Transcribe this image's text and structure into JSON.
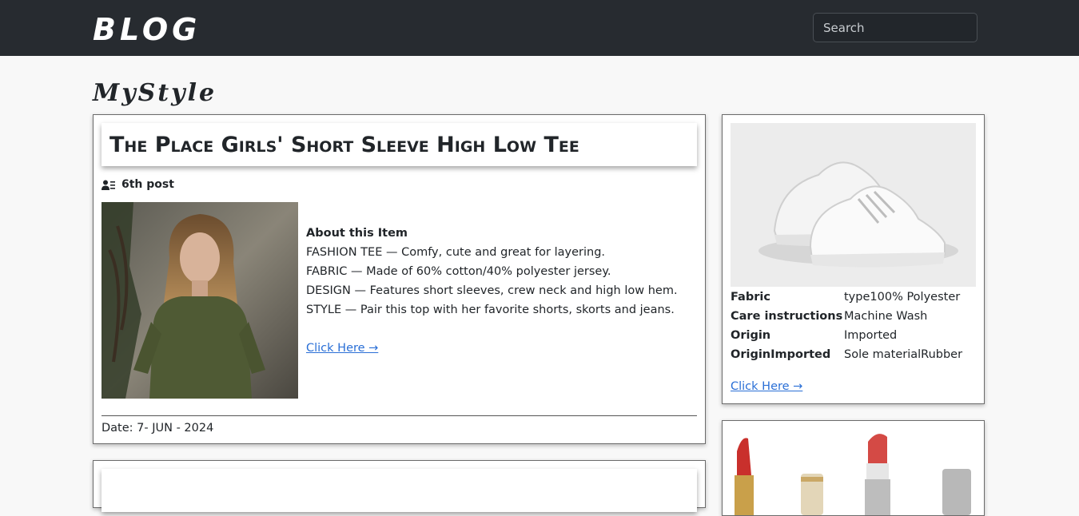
{
  "navbar": {
    "brand": "BLOG",
    "search_placeholder": "Search"
  },
  "site_title": "MyStyle",
  "post": {
    "title": "The Place Girls' Short Sleeve High Low Tee",
    "meta": "6th post",
    "about_heading": "About this Item",
    "lines": [
      "FASHION TEE — Comfy, cute and great for layering.",
      "FABRIC — Made of 60% cotton/40% polyester jersey.",
      "DESIGN — Features short sleeves, crew neck and high low hem.",
      "STYLE — Pair this top with her favorite shorts, skorts and jeans."
    ],
    "link": "Click Here →",
    "date": "Date: 7- JUN - 2024",
    "image_icon": "woman-green-tee-photo"
  },
  "side_product": {
    "image_icon": "white-sneakers-photo",
    "specs": [
      {
        "key": "Fabric",
        "value": "type100% Polyester"
      },
      {
        "key": "Care instructions",
        "value": " Machine Wash"
      },
      {
        "key": "Origin",
        "value": " Imported"
      },
      {
        "key": "OriginImported",
        "value": "Sole materialRubber"
      }
    ],
    "link": "Click Here →"
  },
  "side_product2": {
    "image_icon": "lipsticks-photo"
  },
  "colors": {
    "navbar": "#272b30",
    "link": "#2a6fd6",
    "background": "#f8f8f8"
  }
}
